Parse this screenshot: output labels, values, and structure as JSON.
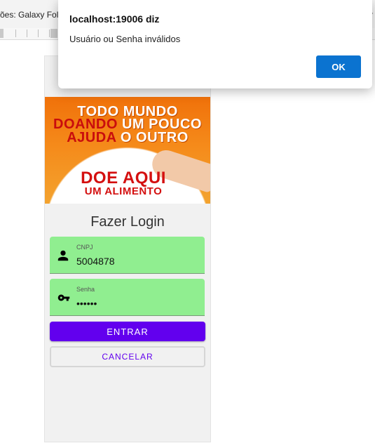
{
  "browser": {
    "device_label": "ões: Galaxy Fold",
    "caret": "▾"
  },
  "banner": {
    "line1": "TODO MUNDO",
    "line2_red": "DOANDO",
    "line2_white": " UM POUCO",
    "line3_red": "AJUDA",
    "line3_white": " O OUTRO",
    "line4": "DOE AQUI",
    "line5": "UM ALIMENTO"
  },
  "login": {
    "title": "Fazer Login",
    "cnpj_label": "CNPJ",
    "cnpj_value": "5004878",
    "senha_label": "Senha",
    "senha_value": "••••••",
    "entrar_label": "ENTRAR",
    "cancelar_label": "CANCELAR"
  },
  "alert": {
    "origin": "localhost:19006 diz",
    "message": "Usuário ou Senha inválidos",
    "ok_label": "OK"
  },
  "colors": {
    "primary": "#6200ee",
    "field_bg": "#90ee90",
    "alert_ok": "#0b73d0"
  }
}
